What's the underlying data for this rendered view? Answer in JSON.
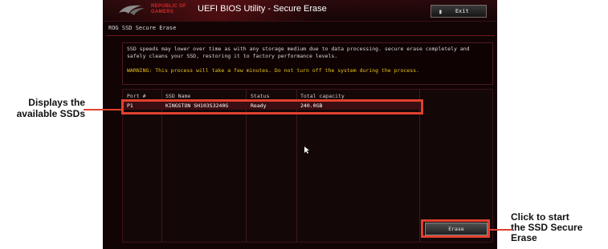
{
  "window": {
    "brand_line1": "REPUBLIC OF",
    "brand_line2": "GAMERS",
    "title": "UEFI BIOS Utility - Secure Erase",
    "exit_label": "Exit",
    "exit_icon": "exit-door-icon"
  },
  "section": {
    "title": "ROG SSD Secure Erase"
  },
  "description": {
    "text": "SSD speeds may lower over time as with any storage medium due to data processing. secure erase completely and safely cleans your SSD, restoring it to factory performance levels.",
    "warning": "WARNING: This process will take a few minutes. Do not turn off the system during the process."
  },
  "table": {
    "headers": [
      "Port #",
      "SSD Name",
      "Status",
      "Total capacity"
    ],
    "rows": [
      {
        "port": "P1",
        "name": "KINGSTON SH103S3240G",
        "status": "Ready",
        "capacity": "240.0GB"
      }
    ]
  },
  "erase_button": {
    "label": "Erase"
  },
  "annotations": {
    "left_callout": [
      "Displays the",
      "available SSDs"
    ],
    "right_callout": [
      "Click to start",
      "the SSD Secure",
      "Erase"
    ],
    "highlight_color": "#e0412e"
  },
  "colors": {
    "bios_background": "#120405",
    "warning_text": "#e6c21a",
    "selected_row": "#3a0e12"
  }
}
